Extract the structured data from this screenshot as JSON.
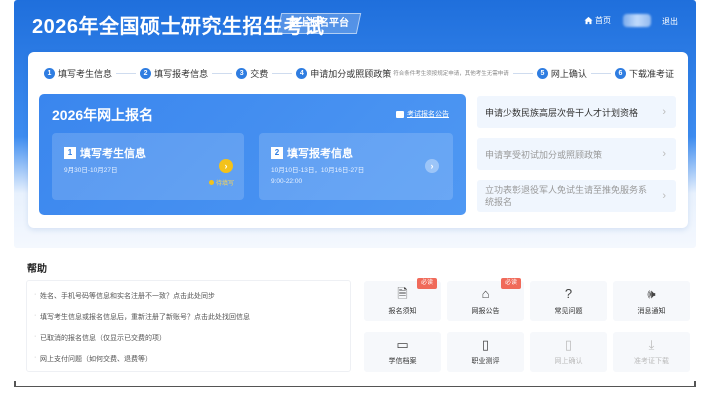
{
  "header": {
    "title": "2026年全国硕士研究生招生考试",
    "platform": "网上报名平台",
    "home": "首页",
    "logout": "退出"
  },
  "steps": [
    {
      "num": "1",
      "label": "填写考生信息"
    },
    {
      "num": "2",
      "label": "填写报考信息"
    },
    {
      "num": "3",
      "label": "交费"
    },
    {
      "num": "4",
      "label": "申请加分或照顾政策",
      "note": "符合条件考生须按规定申请，其他考生无需申请"
    },
    {
      "num": "5",
      "label": "网上确认"
    },
    {
      "num": "6",
      "label": "下载准考证"
    }
  ],
  "registration": {
    "title": "2026年网上报名",
    "notice": "考试报名公告",
    "card1": {
      "num": "1",
      "title": "填写考生信息",
      "dates": "9月30日-10月27日",
      "status": "待填写"
    },
    "card2": {
      "num": "2",
      "title": "填写报考信息",
      "dates_line1": "10月10日-13日，10月16日-27日",
      "dates_line2": "9:00-22:00"
    }
  },
  "policies": [
    "申请少数民族高层次骨干人才计划资格",
    "申请享受初试加分或照顾政策",
    "立功表彰退役军人免试生请至推免服务系统报名"
  ],
  "help": {
    "title": "帮助",
    "faq": [
      "姓名、手机号码等信息和实名注册不一致？点击此处同步",
      "填写考生信息或报名信息后，重新注册了新账号？点击此处找回信息",
      "已取消的报名信息（仅显示已交费的项）",
      "网上支付问题（如何交费、退费等）"
    ]
  },
  "tiles": [
    {
      "label": "报名须知",
      "icon": "document-icon",
      "badge": "必读"
    },
    {
      "label": "网报公告",
      "icon": "announcement-icon",
      "badge": "必读"
    },
    {
      "label": "常见问题",
      "icon": "question-icon"
    },
    {
      "label": "消息通知",
      "icon": "speaker-icon"
    },
    {
      "label": "学信档案",
      "icon": "archive-icon"
    },
    {
      "label": "职业测评",
      "icon": "assessment-icon"
    },
    {
      "label": "网上确认",
      "icon": "confirm-icon",
      "disabled": true
    },
    {
      "label": "准考证下载",
      "icon": "download-icon",
      "disabled": true
    }
  ],
  "colors": {
    "primary": "#2f7de1",
    "accent": "#f3c21b",
    "badge": "#f06a5a"
  }
}
